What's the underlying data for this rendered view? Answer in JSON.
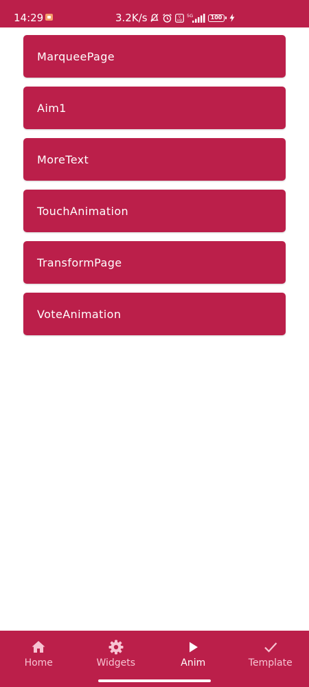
{
  "status_bar": {
    "time": "14:29",
    "network_speed": "3.2K/s",
    "network_type": "5G",
    "battery": "100",
    "icons": [
      "screen-record-icon",
      "mute-icon",
      "alarm-icon",
      "hd-icon",
      "signal-icon",
      "battery-icon",
      "charging-icon"
    ]
  },
  "list": {
    "items": [
      {
        "label": "MarqueePage"
      },
      {
        "label": "Aim1"
      },
      {
        "label": "MoreText"
      },
      {
        "label": "TouchAnimation"
      },
      {
        "label": "TransformPage"
      },
      {
        "label": "VoteAnimation"
      }
    ]
  },
  "bottom_nav": {
    "items": [
      {
        "label": "Home",
        "icon": "home-icon",
        "active": false
      },
      {
        "label": "Widgets",
        "icon": "gear-icon",
        "active": false
      },
      {
        "label": "Anim",
        "icon": "play-icon",
        "active": true
      },
      {
        "label": "Template",
        "icon": "check-icon",
        "active": false
      }
    ]
  },
  "colors": {
    "primary": "#bb1f4a",
    "on_primary": "#ffffff",
    "inactive_nav": "#f7c3d2",
    "background": "#ffffff"
  }
}
